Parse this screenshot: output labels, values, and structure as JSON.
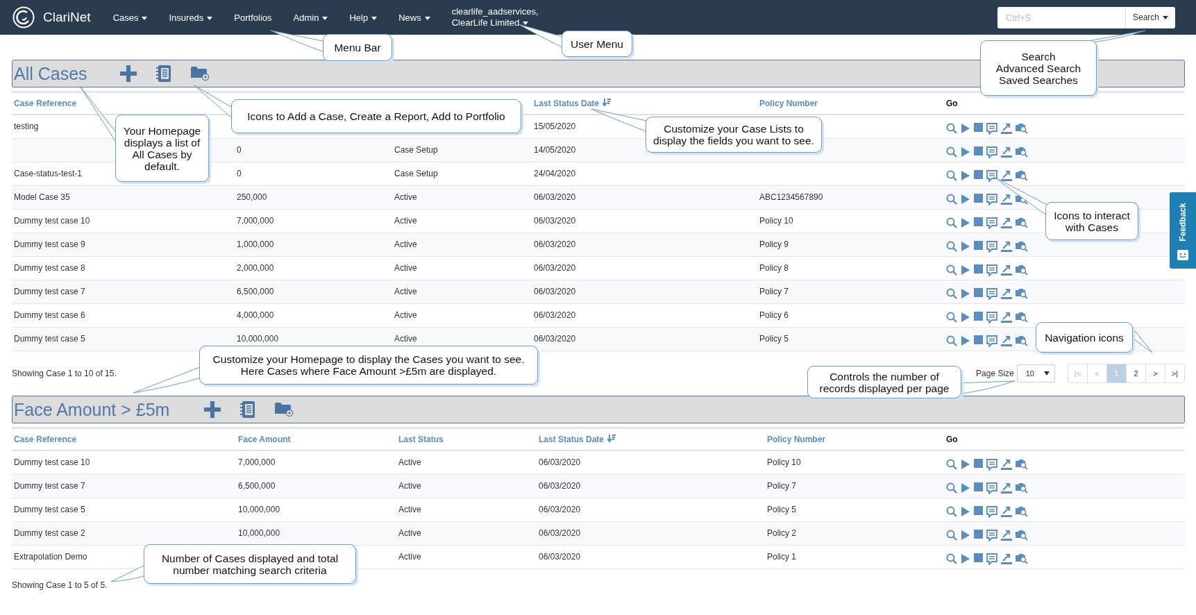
{
  "navbar": {
    "brand": "ClariNet",
    "menu": [
      {
        "label": "Cases",
        "dropdown": true
      },
      {
        "label": "Insureds",
        "dropdown": true
      },
      {
        "label": "Portfolios",
        "dropdown": false
      },
      {
        "label": "Admin",
        "dropdown": true
      },
      {
        "label": "Help",
        "dropdown": true
      },
      {
        "label": "News",
        "dropdown": true
      }
    ],
    "user_menu": {
      "lines": [
        "clearlife_aadservices,",
        "ClearLife Limited"
      ],
      "dropdown": true
    },
    "search": {
      "placeholder": "Ctrl+S",
      "button": "Search"
    }
  },
  "panels": [
    {
      "title": "All Cases",
      "columns": [
        {
          "label": "Case Reference",
          "kind": "link",
          "sorted": false
        },
        {},
        {},
        {
          "label": "Last Status Date",
          "kind": "link",
          "sorted": true
        },
        {
          "label": "Policy Number",
          "kind": "link",
          "sorted": false
        },
        {
          "label": "Go",
          "kind": "plain",
          "sorted": false
        }
      ],
      "rows": [
        [
          "testing",
          null,
          null,
          "15/05/2020",
          null
        ],
        [
          null,
          "0",
          "Case Setup",
          "14/05/2020",
          null
        ],
        [
          "Case-status-test-1",
          "0",
          "Case Setup",
          "24/04/2020",
          null
        ],
        [
          "Model Case 35",
          "250,000",
          "Active",
          "06/03/2020",
          "ABC1234567890"
        ],
        [
          "Dummy test case 10",
          "7,000,000",
          "Active",
          "06/03/2020",
          "Policy 10"
        ],
        [
          "Dummy test case 9",
          "1,000,000",
          "Active",
          "06/03/2020",
          "Policy 9"
        ],
        [
          "Dummy test case 8",
          "2,000,000",
          "Active",
          "06/03/2020",
          "Policy 8"
        ],
        [
          "Dummy test case 7",
          "6,500,000",
          "Active",
          "06/03/2020",
          "Policy 7"
        ],
        [
          "Dummy test case 6",
          "4,000,000",
          "Active",
          "06/03/2020",
          "Policy 6"
        ],
        [
          "Dummy test case 5",
          "10,000,000",
          "Active",
          "06/03/2020",
          "Policy 5"
        ]
      ],
      "footer": "Showing Case 1 to 10 of 15.",
      "page_size": {
        "label": "Page Size",
        "value": "10"
      },
      "pages": [
        {
          "label": "|<",
          "selected": false,
          "disabled": true
        },
        {
          "label": "<",
          "selected": false,
          "disabled": true
        },
        {
          "label": "1",
          "selected": true,
          "disabled": false
        },
        {
          "label": "2",
          "selected": false,
          "disabled": false
        },
        {
          "label": ">",
          "selected": false,
          "disabled": false
        },
        {
          "label": ">|",
          "selected": false,
          "disabled": false
        }
      ]
    },
    {
      "title": "Face Amount > £5m",
      "columns": [
        {
          "label": "Case Reference",
          "kind": "link",
          "sorted": false
        },
        {
          "label": "Face Amount",
          "kind": "link",
          "sorted": false
        },
        {
          "label": "Last Status",
          "kind": "link",
          "sorted": false
        },
        {
          "label": "Last Status Date",
          "kind": "link",
          "sorted": true
        },
        {
          "label": "Policy Number",
          "kind": "link",
          "sorted": false
        },
        {
          "label": "Go",
          "kind": "plain",
          "sorted": false
        }
      ],
      "rows": [
        [
          "Dummy test case 10",
          "7,000,000",
          "Active",
          "06/03/2020",
          "Policy 10"
        ],
        [
          "Dummy test case 7",
          "6,500,000",
          "Active",
          "06/03/2020",
          "Policy 7"
        ],
        [
          "Dummy test case 5",
          "10,000,000",
          "Active",
          "06/03/2020",
          "Policy 5"
        ],
        [
          "Dummy test case 2",
          "10,000,000",
          "Active",
          "06/03/2020",
          "Policy 2"
        ],
        [
          "Extrapolation Demo",
          null,
          "Active",
          "06/03/2020",
          "Policy 1"
        ]
      ],
      "footer": "Showing Case 1 to 5 of 5."
    }
  ],
  "feedback": {
    "label": "Feedback"
  },
  "callouts": [
    {
      "text": "Menu Bar"
    },
    {
      "text": "User Menu"
    },
    {
      "text": "Search\nAdvanced Search\nSaved Searches"
    },
    {
      "text": "Your Homepage\ndisplays a list of\nAll Cases by\ndefault."
    },
    {
      "text": "Icons to Add a Case, Create a Report, Add to Portfolio"
    },
    {
      "text": "Customize your Case Lists to\ndisplay the fields you want to see."
    },
    {
      "text": "Icons to interact\nwith Cases"
    },
    {
      "text": "Navigation icons"
    },
    {
      "text": "Customize your Homepage to display the Cases you want to see.\nHere Cases where Face Amount >£5m are displayed."
    },
    {
      "text": "Controls the number of\nrecords displayed per page"
    },
    {
      "text": "Number of Cases displayed and total\nnumber matching search criteria"
    }
  ]
}
